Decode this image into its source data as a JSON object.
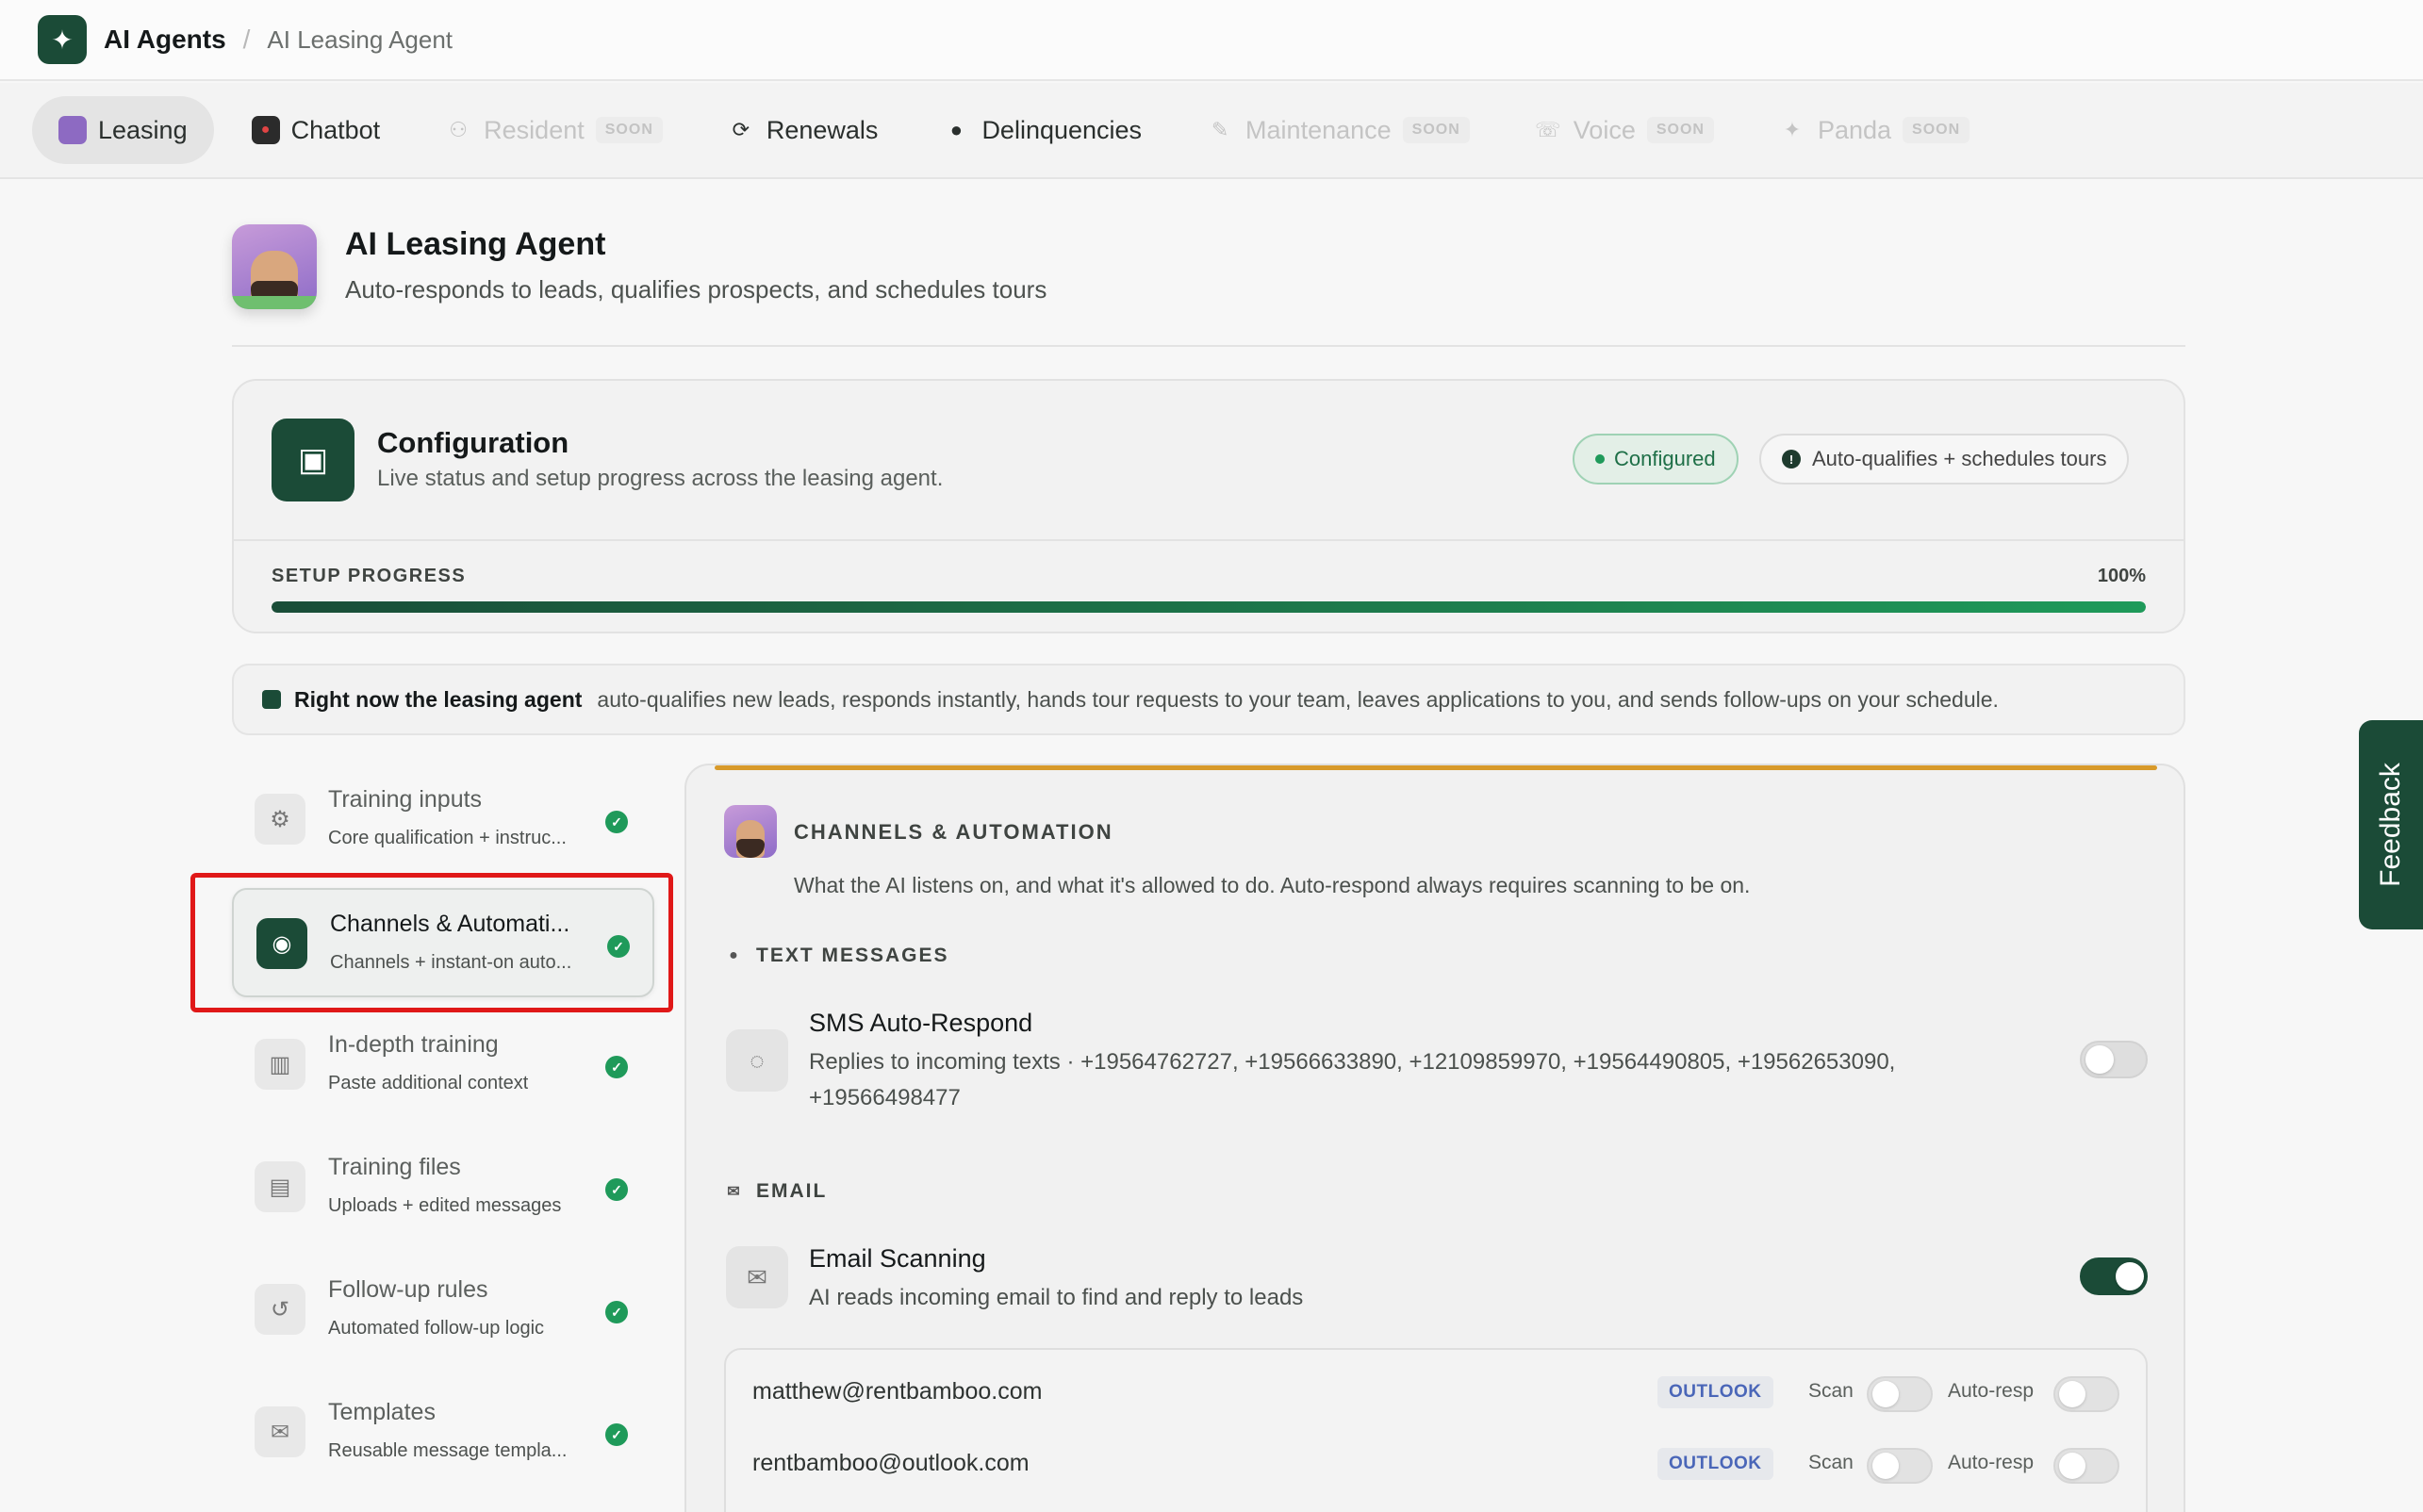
{
  "topbar": {
    "app_name": "AI Agents",
    "separator": "/",
    "current": "AI Leasing Agent"
  },
  "tabs": [
    {
      "label": "Leasing",
      "icon": "leasing-avatar-icon",
      "state": "active"
    },
    {
      "label": "Chatbot",
      "icon": "chatbot-icon",
      "state": "normal"
    },
    {
      "label": "Resident",
      "icon": "resident-icon",
      "state": "disabled",
      "badge": "SOON"
    },
    {
      "label": "Renewals",
      "icon": "refresh-icon",
      "state": "normal"
    },
    {
      "label": "Delinquencies",
      "icon": "alert-circle-icon",
      "state": "normal"
    },
    {
      "label": "Maintenance",
      "icon": "wrench-icon",
      "state": "disabled",
      "badge": "SOON"
    },
    {
      "label": "Voice",
      "icon": "phone-icon",
      "state": "disabled",
      "badge": "SOON"
    },
    {
      "label": "Panda",
      "icon": "sparkle-icon",
      "state": "disabled",
      "badge": "SOON"
    }
  ],
  "agent": {
    "title": "AI Leasing Agent",
    "subtitle": "Auto-responds to leads, qualifies prospects, and schedules tours"
  },
  "configuration": {
    "title": "Configuration",
    "subtitle": "Live status and setup progress across the leasing agent.",
    "status_pill": "Configured",
    "mode_pill": "Auto-qualifies + schedules tours",
    "progress_label": "SETUP PROGRESS",
    "progress_text": "100%",
    "progress_value": 1.0
  },
  "banner": {
    "bold": "Right now the leasing agent",
    "text": "auto-qualifies new leads, responds instantly, hands tour requests to your team, leaves applications to you, and sends follow-ups on your schedule."
  },
  "nav": [
    {
      "label": "Training inputs",
      "sub": "Core qualification + instruc...",
      "icon": "gear-icon",
      "done": true
    },
    {
      "label": "Channels & Automati...",
      "sub": "Channels + instant-on auto...",
      "icon": "channels-icon",
      "done": true,
      "active": true
    },
    {
      "label": "In-depth training",
      "sub": "Paste additional context",
      "icon": "books-icon",
      "done": true
    },
    {
      "label": "Training files",
      "sub": "Uploads + edited messages",
      "icon": "file-icon",
      "done": true
    },
    {
      "label": "Follow-up rules",
      "sub": "Automated follow-up logic",
      "icon": "history-icon",
      "done": true
    },
    {
      "label": "Templates",
      "sub": "Reusable message templa...",
      "icon": "envelope-icon",
      "done": true
    }
  ],
  "panel": {
    "title": "CHANNELS & AUTOMATION",
    "description": "What the AI listens on, and what it's allowed to do. Auto-respond always requires scanning to be on.",
    "text_section": "TEXT MESSAGES",
    "sms": {
      "title": "SMS Auto-Respond",
      "description": "Replies to incoming texts · +19564762727, +19566633890, +12109859970, +19564490805, +19562653090, +19566498477",
      "enabled": false
    },
    "email_section": "EMAIL",
    "email": {
      "title": "Email Scanning",
      "description": "AI reads incoming email to find and reply to leads",
      "enabled": true
    },
    "accounts": [
      {
        "email": "matthew@rentbamboo.com",
        "provider": "OUTLOOK",
        "scan_label": "Scan",
        "auto_label": "Auto-resp",
        "scan": false,
        "auto": false
      },
      {
        "email": "rentbamboo@outlook.com",
        "provider": "OUTLOOK",
        "scan_label": "Scan",
        "auto_label": "Auto-resp",
        "scan": false,
        "auto": false
      }
    ]
  },
  "feedback": {
    "label": "Feedback"
  },
  "colors": {
    "brand": "#1b4b37",
    "success": "#1f9a5a",
    "accent": "#d89a2a",
    "highlight": "#e01818"
  }
}
